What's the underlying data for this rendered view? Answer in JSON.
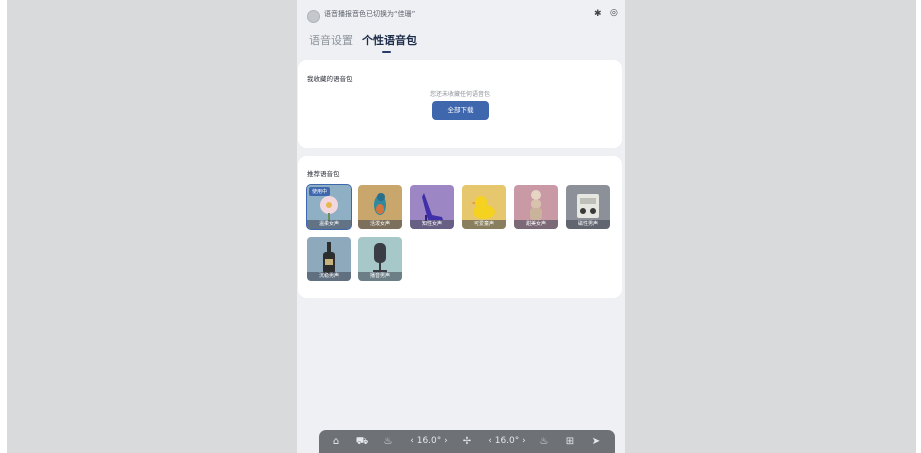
{
  "statusbar": {
    "text": "语音播报音色已切换为“佳珊”",
    "bluetooth_icon": "bluetooth-icon",
    "eye_icon": "eye-icon"
  },
  "tabs": [
    {
      "label": "语音设置",
      "active": false
    },
    {
      "label": "个性语音包",
      "active": true
    }
  ],
  "my_packs": {
    "title": "我收藏的语音包",
    "empty_text": "您还未收藏任何语音包",
    "download_button": "全部下载"
  },
  "recommended": {
    "title": "推荐语音包",
    "in_use_badge": "使用中",
    "items": [
      {
        "label": "温柔女声",
        "color": "#8fb0c4",
        "icon": "flower-icon"
      },
      {
        "label": "活泼女声",
        "color": "#c9a66b",
        "icon": "bird-icon"
      },
      {
        "label": "知性女声",
        "color": "#9d86c4",
        "icon": "high-heel-icon"
      },
      {
        "label": "可爱童声",
        "color": "#e6c76d",
        "icon": "rubber-duck-icon"
      },
      {
        "label": "甜美女声",
        "color": "#c99aa6",
        "icon": "figure-icon"
      },
      {
        "label": "磁性男声",
        "color": "#8c9098",
        "icon": "radio-icon"
      },
      {
        "label": "沉稳男声",
        "color": "#8ea9bb",
        "icon": "bottle-icon"
      },
      {
        "label": "播音男声",
        "color": "#a6c8c8",
        "icon": "microphone-icon"
      }
    ]
  },
  "bottombar": {
    "home_icon": "home-icon",
    "car_icon": "car-icon",
    "seat_heat_left_icon": "seat-heat-icon",
    "left_temp": "‹ 16.0° ›",
    "fan_icon": "fan-icon",
    "right_temp": "‹ 16.0° ›",
    "seat_heat_right_icon": "seat-heat-icon",
    "grid_icon": "grid-icon",
    "nav_icon": "navigation-icon"
  }
}
